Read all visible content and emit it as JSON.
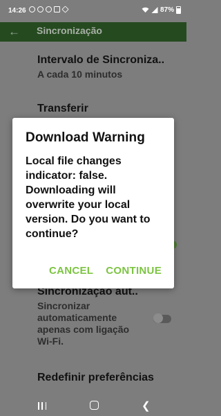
{
  "status_bar": {
    "time": "14:26",
    "battery": "87%",
    "left_icons": [
      "messaging-icon",
      "messaging-icon",
      "vpn-icon",
      "gallery-icon",
      "dropbox-icon"
    ],
    "right_icons": [
      "wifi-icon",
      "signal-icon",
      "battery-icon"
    ]
  },
  "toolbar": {
    "title": "Sincronização",
    "back_icon": "arrow-left-icon"
  },
  "settings": {
    "interval": {
      "title": "Intervalo de Sincroniza..",
      "subtitle": "A cada 10 minutos"
    },
    "transfer": {
      "title": "Transferir"
    },
    "auto_sync": {
      "title": "Sincronização aut..",
      "subtitle": "Sincronizar automaticamente apenas com ligação Wi-Fi.",
      "enabled": false
    },
    "reset": {
      "title": "Redefinir preferências"
    }
  },
  "dialog": {
    "title": "Download Warning",
    "message": "Local file changes indicator: false. Downloading will overwrite your local version. Do you want to continue?",
    "cancel_label": "CANCEL",
    "continue_label": "CONTINUE"
  },
  "colors": {
    "toolbar_bg": "#254a1f",
    "accent": "#7cc442",
    "scrim": "#7d7d7d"
  }
}
